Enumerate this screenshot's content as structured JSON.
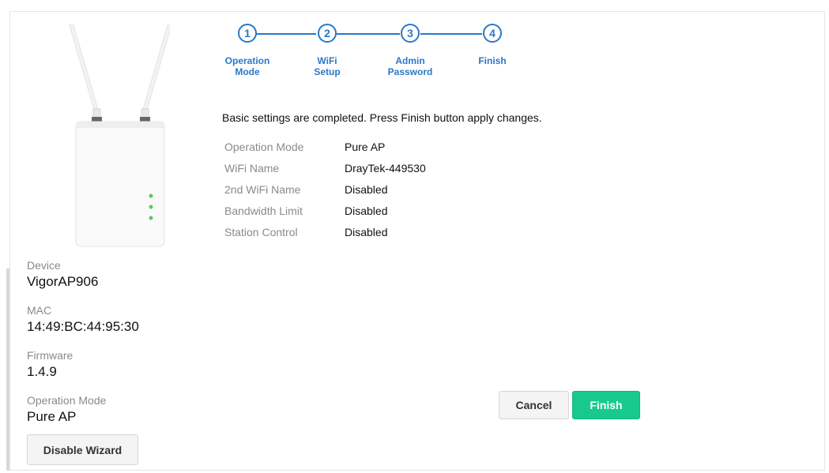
{
  "wizard": {
    "steps": [
      {
        "number": "1",
        "label": "Operation\nMode"
      },
      {
        "number": "2",
        "label": "WiFi\nSetup"
      },
      {
        "number": "3",
        "label": "Admin\nPassword"
      },
      {
        "number": "4",
        "label": "Finish"
      }
    ],
    "summary_text": "Basic settings are completed. Press Finish button apply changes.",
    "settings": [
      {
        "key": "Operation Mode",
        "value": "Pure AP"
      },
      {
        "key": "WiFi Name",
        "value": "DrayTek-449530"
      },
      {
        "key": "2nd WiFi Name",
        "value": "Disabled"
      },
      {
        "key": "Bandwidth Limit",
        "value": "Disabled"
      },
      {
        "key": "Station Control",
        "value": "Disabled"
      }
    ],
    "cancel_label": "Cancel",
    "finish_label": "Finish"
  },
  "device_info": {
    "device_label": "Device",
    "device_value": "VigorAP906",
    "mac_label": "MAC",
    "mac_value": "14:49:BC:44:95:30",
    "firmware_label": "Firmware",
    "firmware_value": "1.4.9",
    "opmode_label": "Operation Mode",
    "opmode_value": "Pure AP"
  },
  "disable_wizard_label": "Disable Wizard",
  "colors": {
    "accent": "#2a78c8",
    "finish_button": "#18c98e",
    "led": "#5cc860"
  }
}
